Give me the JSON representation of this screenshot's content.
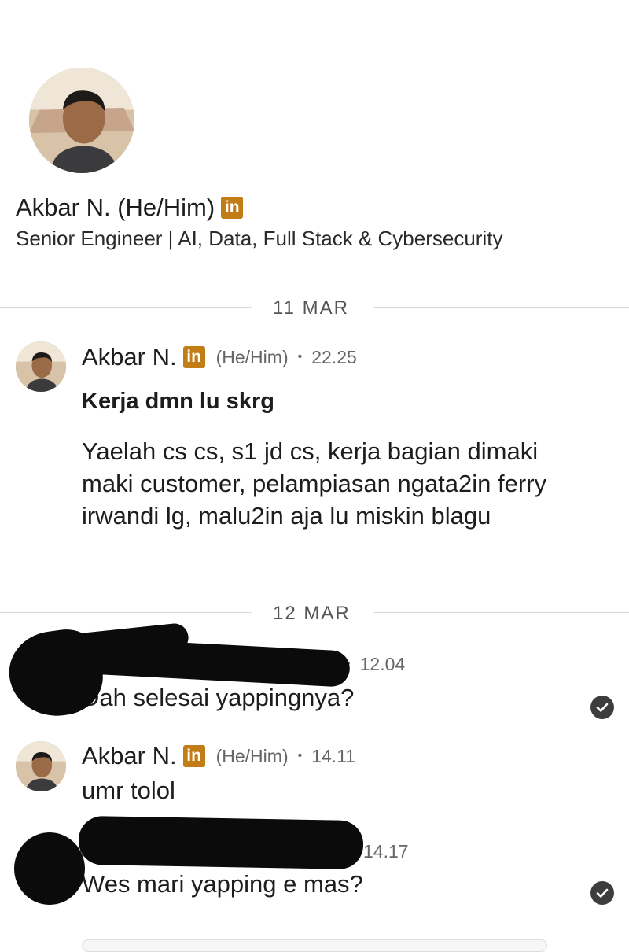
{
  "profile": {
    "name": "Akbar N. (He/Him)",
    "badge": "in",
    "headline": "Senior Engineer | AI, Data, Full Stack & Cybersecurity"
  },
  "dates": [
    "11 MAR",
    "12 MAR"
  ],
  "messages": [
    {
      "sender": "Akbar N.",
      "badge": "in",
      "pronouns": "(He/Him)",
      "separator": "•",
      "time": "22.25",
      "subject": "Kerja dmn lu skrg",
      "text": "Yaelah cs cs, s1 jd cs, kerja bagian dimaki maki customer, pelampiasan ngata2in ferry irwandi lg, malu2in aja lu miskin blagu"
    },
    {
      "separator": "•",
      "time": "12.04",
      "text": "Dah selesai yappingnya?",
      "status_icon": "check-circle-icon"
    },
    {
      "sender": "Akbar N.",
      "badge": "in",
      "pronouns": "(He/Him)",
      "separator": "•",
      "time": "14.11",
      "text": "umr tolol"
    },
    {
      "time": "14.17",
      "text": "Wes mari yapping e mas?",
      "status_icon": "check-circle-icon"
    }
  ],
  "colors": {
    "linkedin_badge": "#c37d16",
    "divider": "#d9d9d9",
    "redaction": "#0b0b0b"
  }
}
